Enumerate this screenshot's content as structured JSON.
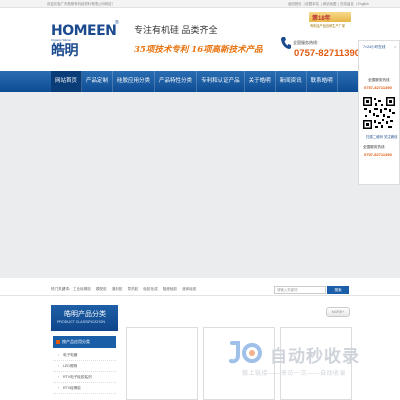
{
  "topbar": {
    "welcome": "欢迎光临广东皓明有机硅材料有限公司网站！",
    "links": [
      "返回首页",
      "收藏本站",
      "网站地图",
      "在线留言",
      "English"
    ]
  },
  "header": {
    "logo_text": "HOMEEN",
    "logo_cn": "皓明",
    "logo_reg": "®",
    "logo_sub": "Organic Silicon",
    "slogan": "专注有机硅 品类齐全",
    "slogan2": "35项技术专利 16项高新技术产品",
    "badge_num": "第18年",
    "badge_text": "",
    "badge_sub": "有机硅产品自研生产厂家",
    "hotline_label": "全国服务热线：",
    "hotline": "0757-82711390"
  },
  "nav": {
    "items": [
      "网站首页",
      "产品定制",
      "硅胶应用分类",
      "产品特性分类",
      "专利和认证产品",
      "关于皓明",
      "新闻资讯",
      "联系皓明"
    ]
  },
  "float_panel": {
    "title": "7×24小时在线",
    "close": "×",
    "line1": "全国服务热线",
    "phone": "0757-82711390",
    "qr_caption": "扫描二维码 关注微信",
    "line2": "全国服务热线",
    "phone2": "0757-82711390"
  },
  "searchbar": {
    "hot_label": "热门关键词：",
    "hot_items": [
      "工业硅橡胶",
      "模型胶",
      "灌封胶",
      "导热胶",
      "硅胶化成",
      "阻燃硅胶",
      "液体硅胶"
    ],
    "placeholder": "请输入关键词",
    "button": "搜索"
  },
  "sidebar": {
    "title": "皓明产品分类",
    "subtitle": "PRODUCT CLASSIFICATION",
    "category": "按产品应用分类",
    "items": [
      "电子电器",
      "LED照明",
      "RTV电子硅胶粘剂",
      "RTV硅橡胶"
    ]
  },
  "more_button": "MORE+",
  "watermark": {
    "title": "自动秒收录",
    "sub": "做上链接——来访一次——自动收录"
  },
  "colors": {
    "brand_blue": "#1b4a8e",
    "nav_blue": "#0e4c93",
    "accent_orange": "#e05a0e"
  }
}
